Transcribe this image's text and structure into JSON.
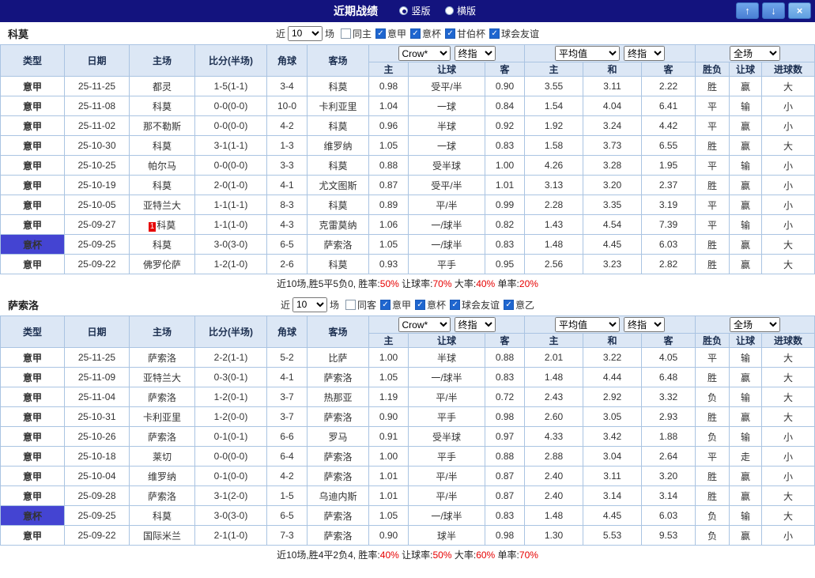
{
  "titlebar": {
    "title": "近期战绩",
    "view_vertical": "竖版",
    "view_horizontal": "横版",
    "up_icon": "↑",
    "down_icon": "↓",
    "close_icon": "×"
  },
  "filter_labels": {
    "near": "近",
    "matches": "场"
  },
  "table_header": {
    "cols": [
      "类型",
      "日期",
      "主场",
      "比分(半场)",
      "角球",
      "客场"
    ],
    "asia_select": "Crow*",
    "asia_final_select": "终指",
    "asia_cols": [
      "主",
      "让球",
      "客"
    ],
    "europe_select": "平均值",
    "europe_final_select": "终指",
    "europe_cols": [
      "主",
      "和",
      "客"
    ],
    "result_select": "全场",
    "result_cols": [
      "胜负",
      "让球",
      "进球数"
    ]
  },
  "colors": {
    "titlebar_navy": "#13137e",
    "league_blue": "#1e8ff2",
    "cup_purple": "#4444d2",
    "win_red": "#e60000",
    "lose_green": "#008800",
    "push_orange": "#e07800",
    "focus_team_green": "#008800",
    "header_bg": "#dce7f5",
    "grid_border": "#aac4e2"
  },
  "sections": [
    {
      "team": "科莫",
      "filter": {
        "count": "10",
        "checks": [
          {
            "label": "同主",
            "checked": false
          },
          {
            "label": "意甲",
            "checked": true
          },
          {
            "label": "意杯",
            "checked": true
          },
          {
            "label": "甘伯杯",
            "checked": true
          },
          {
            "label": "球会友谊",
            "checked": true
          }
        ]
      },
      "rows": [
        {
          "type": "意甲",
          "cup": false,
          "date": "25-11-25",
          "home": "都灵",
          "home_focus": false,
          "score": "1-5(1-1)",
          "corner": "3-4",
          "away": "科莫",
          "away_focus": true,
          "asia": [
            "0.98",
            "受平/半",
            "0.90"
          ],
          "avg": [
            "3.55",
            "3.11",
            "2.22"
          ],
          "res": [
            [
              "胜",
              "r"
            ],
            [
              "赢",
              "r"
            ],
            [
              "大",
              "r"
            ]
          ]
        },
        {
          "type": "意甲",
          "cup": false,
          "date": "25-11-08",
          "home": "科莫",
          "home_focus": true,
          "score": "0-0(0-0)",
          "corner": "10-0",
          "away": "卡利亚里",
          "away_focus": false,
          "asia": [
            "1.04",
            "一球",
            "0.84"
          ],
          "avg": [
            "1.54",
            "4.04",
            "6.41"
          ],
          "res": [
            [
              "平",
              "g"
            ],
            [
              "输",
              "g"
            ],
            [
              "小",
              "g"
            ]
          ]
        },
        {
          "type": "意甲",
          "cup": false,
          "date": "25-11-02",
          "home": "那不勒斯",
          "home_focus": false,
          "score": "0-0(0-0)",
          "corner": "4-2",
          "away": "科莫",
          "away_focus": true,
          "asia": [
            "0.96",
            "半球",
            "0.92"
          ],
          "avg": [
            "1.92",
            "3.24",
            "4.42"
          ],
          "res": [
            [
              "平",
              "g"
            ],
            [
              "赢",
              "r"
            ],
            [
              "小",
              "g"
            ]
          ]
        },
        {
          "type": "意甲",
          "cup": false,
          "date": "25-10-30",
          "home": "科莫",
          "home_focus": true,
          "score": "3-1(1-1)",
          "corner": "1-3",
          "away": "维罗纳",
          "away_focus": false,
          "asia": [
            "1.05",
            "一球",
            "0.83"
          ],
          "avg": [
            "1.58",
            "3.73",
            "6.55"
          ],
          "res": [
            [
              "胜",
              "r"
            ],
            [
              "赢",
              "r"
            ],
            [
              "大",
              "r"
            ]
          ]
        },
        {
          "type": "意甲",
          "cup": false,
          "date": "25-10-25",
          "home": "帕尔马",
          "home_focus": false,
          "score": "0-0(0-0)",
          "corner": "3-3",
          "away": "科莫",
          "away_focus": true,
          "asia": [
            "0.88",
            "受半球",
            "1.00"
          ],
          "avg": [
            "4.26",
            "3.28",
            "1.95"
          ],
          "res": [
            [
              "平",
              "g"
            ],
            [
              "输",
              "g"
            ],
            [
              "小",
              "g"
            ]
          ]
        },
        {
          "type": "意甲",
          "cup": false,
          "date": "25-10-19",
          "home": "科莫",
          "home_focus": true,
          "score": "2-0(1-0)",
          "corner": "4-1",
          "away": "尤文图斯",
          "away_focus": false,
          "asia": [
            "0.87",
            "受平/半",
            "1.01"
          ],
          "avg": [
            "3.13",
            "3.20",
            "2.37"
          ],
          "res": [
            [
              "胜",
              "r"
            ],
            [
              "赢",
              "r"
            ],
            [
              "小",
              "g"
            ]
          ]
        },
        {
          "type": "意甲",
          "cup": false,
          "date": "25-10-05",
          "home": "亚特兰大",
          "home_focus": false,
          "score": "1-1(1-1)",
          "corner": "8-3",
          "away": "科莫",
          "away_focus": true,
          "asia": [
            "0.89",
            "平/半",
            "0.99"
          ],
          "avg": [
            "2.28",
            "3.35",
            "3.19"
          ],
          "res": [
            [
              "平",
              "g"
            ],
            [
              "赢",
              "r"
            ],
            [
              "小",
              "g"
            ]
          ]
        },
        {
          "type": "意甲",
          "cup": false,
          "date": "25-09-27",
          "home": "科莫",
          "home_focus": true,
          "badge": "1",
          "score": "1-1(1-0)",
          "corner": "4-3",
          "away": "克雷莫纳",
          "away_focus": false,
          "asia": [
            "1.06",
            "一/球半",
            "0.82"
          ],
          "avg": [
            "1.43",
            "4.54",
            "7.39"
          ],
          "res": [
            [
              "平",
              "g"
            ],
            [
              "输",
              "g"
            ],
            [
              "小",
              "g"
            ]
          ]
        },
        {
          "type": "意杯",
          "cup": true,
          "date": "25-09-25",
          "home": "科莫",
          "home_focus": true,
          "score": "3-0(3-0)",
          "corner": "6-5",
          "away": "萨索洛",
          "away_focus": false,
          "asia": [
            "1.05",
            "一/球半",
            "0.83"
          ],
          "avg": [
            "1.48",
            "4.45",
            "6.03"
          ],
          "res": [
            [
              "胜",
              "r"
            ],
            [
              "赢",
              "r"
            ],
            [
              "大",
              "r"
            ]
          ]
        },
        {
          "type": "意甲",
          "cup": false,
          "date": "25-09-22",
          "home": "佛罗伦萨",
          "home_focus": false,
          "score": "1-2(1-0)",
          "corner": "2-6",
          "away": "科莫",
          "away_focus": true,
          "asia": [
            "0.93",
            "平手",
            "0.95"
          ],
          "avg": [
            "2.56",
            "3.23",
            "2.82"
          ],
          "res": [
            [
              "胜",
              "r"
            ],
            [
              "赢",
              "r"
            ],
            [
              "大",
              "r"
            ]
          ]
        }
      ],
      "summary": [
        [
          "近10场,胜5平5负0, 胜率:",
          false
        ],
        [
          "50%",
          true
        ],
        [
          " 让球率:",
          false
        ],
        [
          "70%",
          true
        ],
        [
          " 大率:",
          false
        ],
        [
          "40%",
          true
        ],
        [
          " 单率:",
          false
        ],
        [
          "20%",
          true
        ]
      ]
    },
    {
      "team": "萨索洛",
      "filter": {
        "count": "10",
        "checks": [
          {
            "label": "同客",
            "checked": false
          },
          {
            "label": "意甲",
            "checked": true
          },
          {
            "label": "意杯",
            "checked": true
          },
          {
            "label": "球会友谊",
            "checked": true
          },
          {
            "label": "意乙",
            "checked": true
          }
        ]
      },
      "rows": [
        {
          "type": "意甲",
          "cup": false,
          "date": "25-11-25",
          "home": "萨索洛",
          "home_focus": true,
          "score": "2-2(1-1)",
          "corner": "5-2",
          "away": "比萨",
          "away_focus": false,
          "asia": [
            "1.00",
            "半球",
            "0.88"
          ],
          "avg": [
            "2.01",
            "3.22",
            "4.05"
          ],
          "res": [
            [
              "平",
              "g"
            ],
            [
              "输",
              "g"
            ],
            [
              "大",
              "r"
            ]
          ]
        },
        {
          "type": "意甲",
          "cup": false,
          "date": "25-11-09",
          "home": "亚特兰大",
          "home_focus": false,
          "score": "0-3(0-1)",
          "corner": "4-1",
          "away": "萨索洛",
          "away_focus": true,
          "asia": [
            "1.05",
            "一/球半",
            "0.83"
          ],
          "avg": [
            "1.48",
            "4.44",
            "6.48"
          ],
          "res": [
            [
              "胜",
              "r"
            ],
            [
              "赢",
              "r"
            ],
            [
              "大",
              "r"
            ]
          ]
        },
        {
          "type": "意甲",
          "cup": false,
          "date": "25-11-04",
          "home": "萨索洛",
          "home_focus": true,
          "score": "1-2(0-1)",
          "corner": "3-7",
          "away": "热那亚",
          "away_focus": false,
          "asia": [
            "1.19",
            "平/半",
            "0.72"
          ],
          "avg": [
            "2.43",
            "2.92",
            "3.32"
          ],
          "res": [
            [
              "负",
              "g"
            ],
            [
              "输",
              "g"
            ],
            [
              "大",
              "r"
            ]
          ]
        },
        {
          "type": "意甲",
          "cup": false,
          "date": "25-10-31",
          "home": "卡利亚里",
          "home_focus": false,
          "score": "1-2(0-0)",
          "corner": "3-7",
          "away": "萨索洛",
          "away_focus": true,
          "asia": [
            "0.90",
            "平手",
            "0.98"
          ],
          "avg": [
            "2.60",
            "3.05",
            "2.93"
          ],
          "res": [
            [
              "胜",
              "r"
            ],
            [
              "赢",
              "r"
            ],
            [
              "大",
              "r"
            ]
          ]
        },
        {
          "type": "意甲",
          "cup": false,
          "date": "25-10-26",
          "home": "萨索洛",
          "home_focus": true,
          "score": "0-1(0-1)",
          "corner": "6-6",
          "away": "罗马",
          "away_focus": false,
          "asia": [
            "0.91",
            "受半球",
            "0.97"
          ],
          "avg": [
            "4.33",
            "3.42",
            "1.88"
          ],
          "res": [
            [
              "负",
              "g"
            ],
            [
              "输",
              "g"
            ],
            [
              "小",
              "g"
            ]
          ]
        },
        {
          "type": "意甲",
          "cup": false,
          "date": "25-10-18",
          "home": "莱切",
          "home_focus": false,
          "score": "0-0(0-0)",
          "corner": "6-4",
          "away": "萨索洛",
          "away_focus": true,
          "asia": [
            "1.00",
            "平手",
            "0.88"
          ],
          "avg": [
            "2.88",
            "3.04",
            "2.64"
          ],
          "res": [
            [
              "平",
              "g"
            ],
            [
              "走",
              "o"
            ],
            [
              "小",
              "g"
            ]
          ]
        },
        {
          "type": "意甲",
          "cup": false,
          "date": "25-10-04",
          "home": "维罗纳",
          "home_focus": false,
          "score": "0-1(0-0)",
          "corner": "4-2",
          "away": "萨索洛",
          "away_focus": true,
          "asia": [
            "1.01",
            "平/半",
            "0.87"
          ],
          "avg": [
            "2.40",
            "3.11",
            "3.20"
          ],
          "res": [
            [
              "胜",
              "r"
            ],
            [
              "赢",
              "r"
            ],
            [
              "小",
              "g"
            ]
          ]
        },
        {
          "type": "意甲",
          "cup": false,
          "date": "25-09-28",
          "home": "萨索洛",
          "home_focus": true,
          "score": "3-1(2-0)",
          "corner": "1-5",
          "away": "乌迪内斯",
          "away_focus": false,
          "asia": [
            "1.01",
            "平/半",
            "0.87"
          ],
          "avg": [
            "2.40",
            "3.14",
            "3.14"
          ],
          "res": [
            [
              "胜",
              "r"
            ],
            [
              "赢",
              "r"
            ],
            [
              "大",
              "r"
            ]
          ]
        },
        {
          "type": "意杯",
          "cup": true,
          "date": "25-09-25",
          "home": "科莫",
          "home_focus": false,
          "score": "3-0(3-0)",
          "corner": "6-5",
          "away": "萨索洛",
          "away_focus": true,
          "asia": [
            "1.05",
            "一/球半",
            "0.83"
          ],
          "avg": [
            "1.48",
            "4.45",
            "6.03"
          ],
          "res": [
            [
              "负",
              "g"
            ],
            [
              "输",
              "g"
            ],
            [
              "大",
              "r"
            ]
          ]
        },
        {
          "type": "意甲",
          "cup": false,
          "date": "25-09-22",
          "home": "国际米兰",
          "home_focus": false,
          "score": "2-1(1-0)",
          "corner": "7-3",
          "away": "萨索洛",
          "away_focus": true,
          "asia": [
            "0.90",
            "球半",
            "0.98"
          ],
          "avg": [
            "1.30",
            "5.53",
            "9.53"
          ],
          "res": [
            [
              "负",
              "g"
            ],
            [
              "赢",
              "r"
            ],
            [
              "小",
              "g"
            ]
          ]
        }
      ],
      "summary": [
        [
          "近10场,胜4平2负4, 胜率:",
          false
        ],
        [
          "40%",
          true
        ],
        [
          " 让球率:",
          false
        ],
        [
          "50%",
          true
        ],
        [
          " 大率:",
          false
        ],
        [
          "60%",
          true
        ],
        [
          " 单率:",
          false
        ],
        [
          "70%",
          true
        ]
      ]
    }
  ]
}
